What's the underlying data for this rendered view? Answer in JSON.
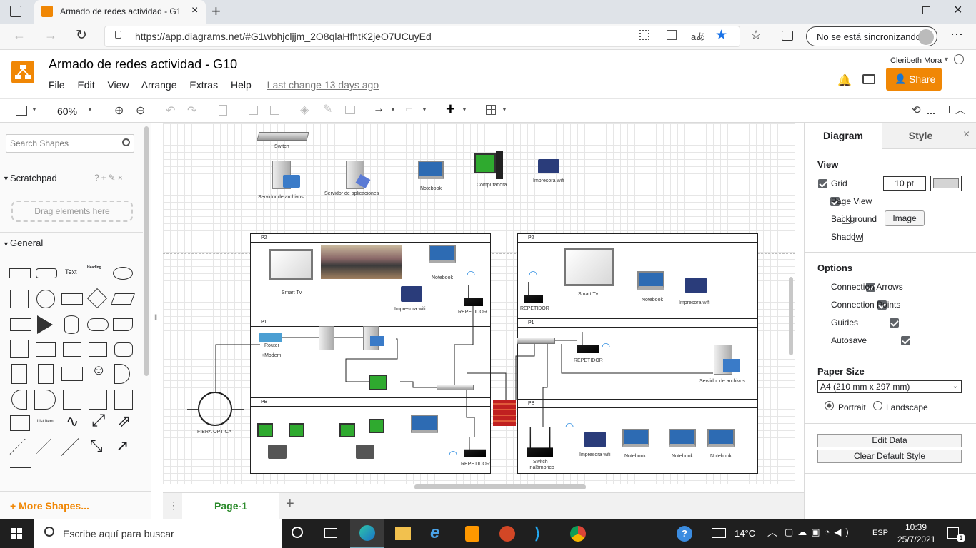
{
  "browser": {
    "tab_title": "Armado de redes actividad - G1(",
    "url": "https://app.diagrams.net/#G1wbhjcljjm_2O8qlaHfhtK2jeO7UCuyEd",
    "sync_label": "No se está sincronizando"
  },
  "app": {
    "title": "Armado de redes actividad - G10",
    "menu": [
      "File",
      "Edit",
      "View",
      "Arrange",
      "Extras",
      "Help"
    ],
    "last_change": "Last change 13 days ago",
    "user": "Cleribeth Mora",
    "share_label": "Share"
  },
  "toolbar": {
    "zoom": "60%"
  },
  "left_panel": {
    "search_placeholder": "Search Shapes",
    "scratchpad_title": "Scratchpad",
    "scratchpad_hint": "Drag elements here",
    "general_title": "General",
    "shape_text_label": "Text",
    "shape_heading_label": "Heading",
    "shape_list_label": "List Item",
    "more_shapes": "+ More Shapes..."
  },
  "right_panel": {
    "tab_diagram": "Diagram",
    "tab_style": "Style",
    "view_title": "View",
    "grid_label": "Grid",
    "grid_size": "10 pt",
    "page_view_label": "Page View",
    "background_label": "Background",
    "image_button": "Image",
    "shadow_label": "Shadow",
    "options_title": "Options",
    "connection_arrows": "Connection Arrows",
    "connection_points": "Connection Points",
    "guides": "Guides",
    "autosave": "Autosave",
    "paper_size_title": "Paper Size",
    "paper_size_value": "A4 (210 mm x 297 mm)",
    "portrait": "Portrait",
    "landscape": "Landscape",
    "edit_data": "Edit Data",
    "clear_default_style": "Clear Default Style",
    "grid_checked": true,
    "page_view_checked": true,
    "background_checked": false,
    "shadow_checked": false
  },
  "page_tab": "Page-1",
  "diagram": {
    "switch": "Switch",
    "file_server": "Servidor de archivos",
    "app_server": "Servidor de aplicaciones",
    "notebook": "Notebook",
    "computer": "Computadora",
    "wifi_printer": "Impresora wifi",
    "p2": "P2",
    "p1": "P1",
    "pb": "PB",
    "smart_tv": "Smart Tv",
    "repeater": "REPETIDOR",
    "router": "Router",
    "modem": "+Modem",
    "fiber": "FIBRA OPTICA",
    "wireless_switch_1": "Switch",
    "wireless_switch_2": "inalámbrico"
  },
  "taskbar": {
    "search_placeholder": "Escribe aquí para buscar",
    "weather": "14°C",
    "lang": "ESP",
    "time": "10:39",
    "date": "25/7/2021",
    "notifications": "1"
  }
}
